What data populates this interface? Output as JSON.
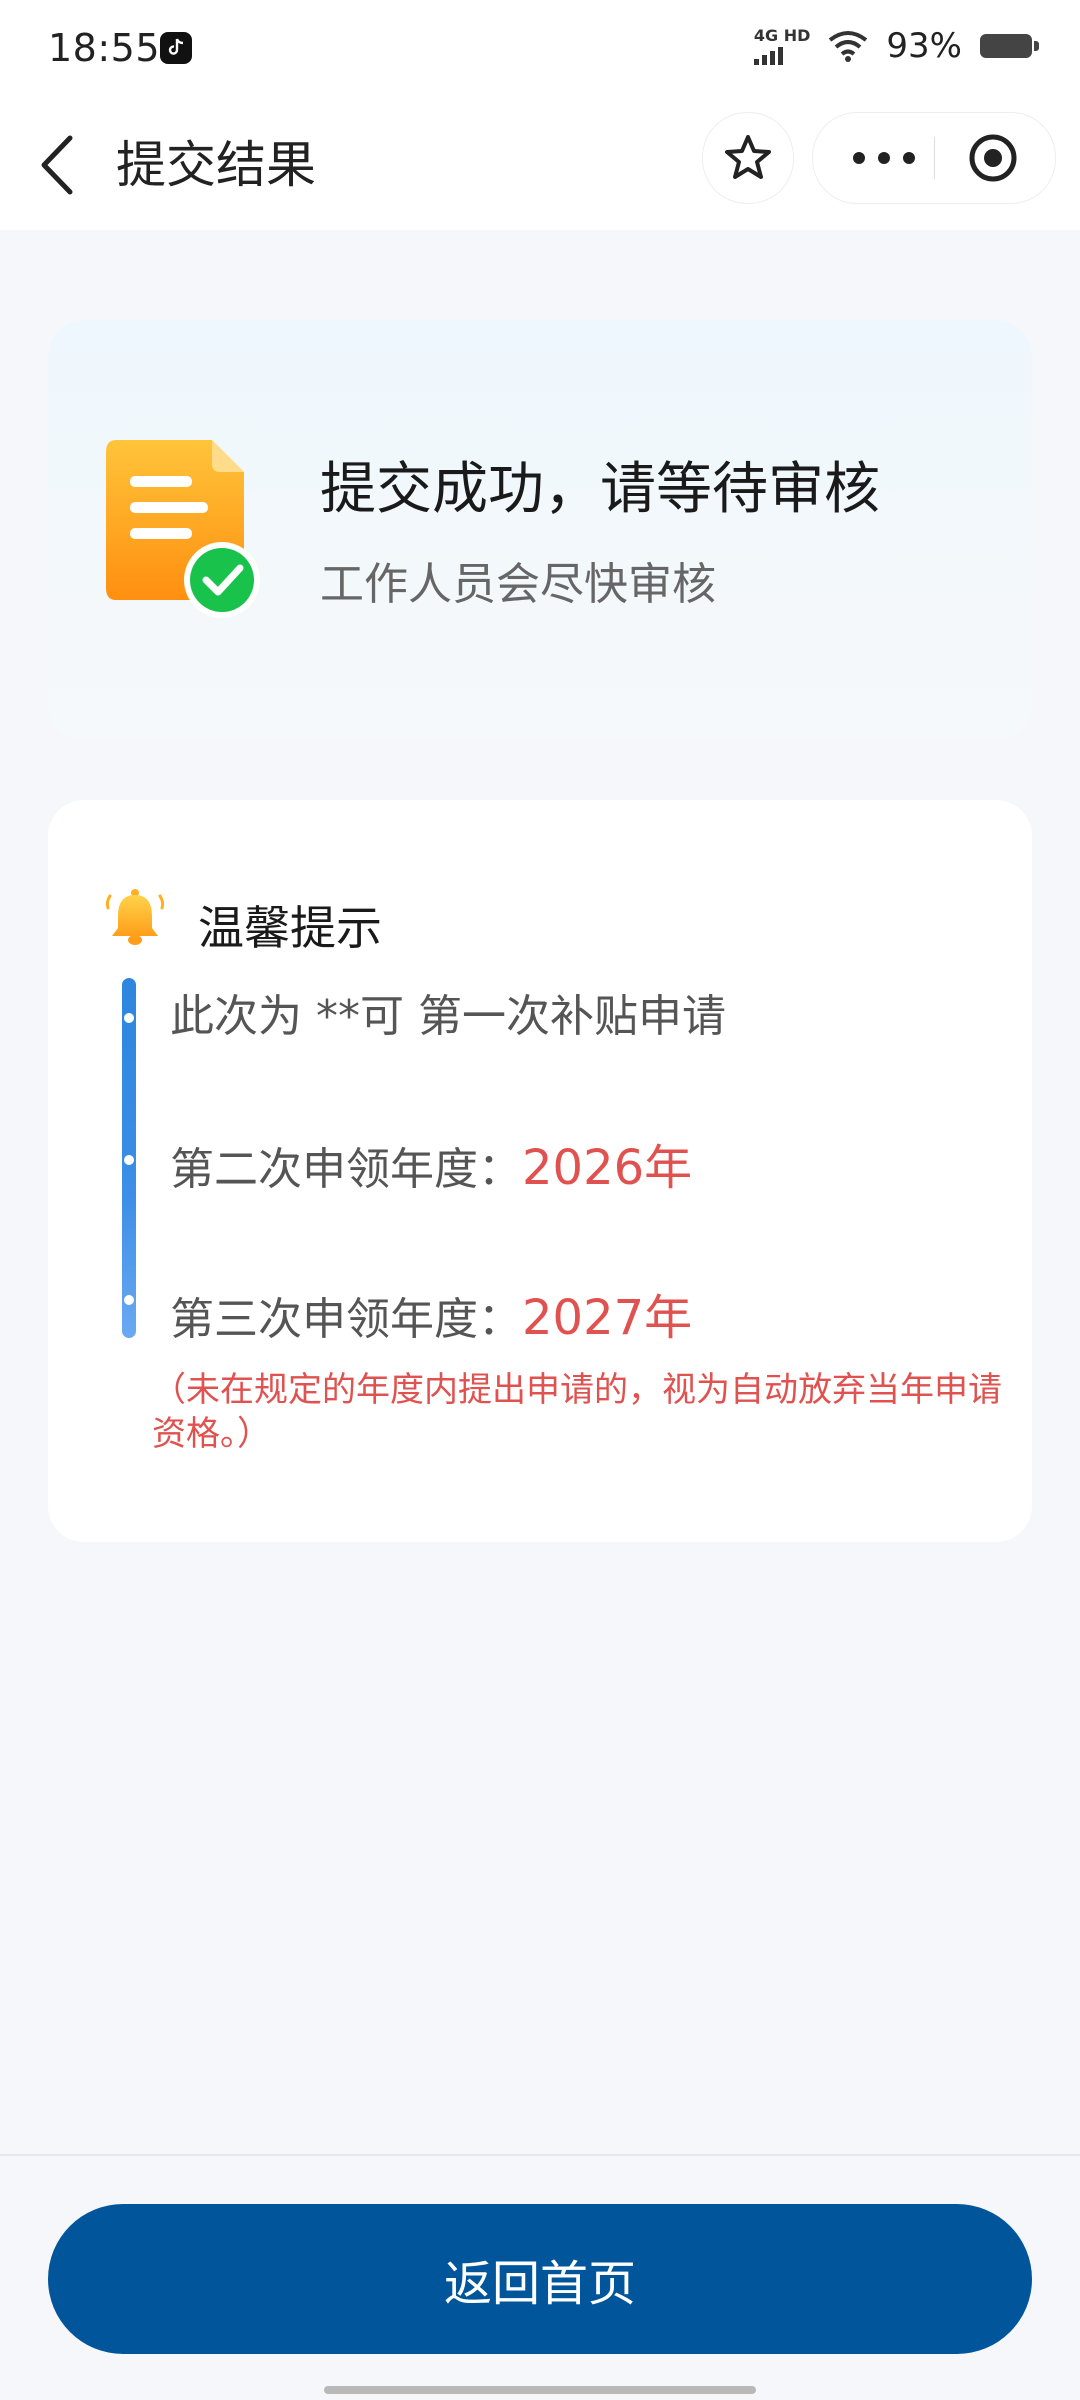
{
  "status_bar": {
    "time": "18:55",
    "network": "4G HD",
    "battery": "93%"
  },
  "header": {
    "title": "提交结果",
    "icons": [
      "back-arrow-icon",
      "star-icon",
      "more-icon",
      "target-icon"
    ]
  },
  "success": {
    "title": "提交成功，请等待审核",
    "subtitle": "工作人员会尽快审核",
    "icon": "document-check-icon"
  },
  "tips": {
    "title": "温馨提示",
    "icon": "bell-icon",
    "line1": "此次为 **可 第一次补贴申请",
    "line2_label": "第二次申领年度：",
    "line2_year": "2026年",
    "line3_label": "第三次申领年度：",
    "line3_year": "2027年",
    "note": "（未在规定的年度内提出申请的，视为自动放弃当年申请资格。）"
  },
  "footer": {
    "button_label": "返回首页"
  },
  "colors": {
    "primary": "#01569b",
    "highlight": "#e0524f",
    "timeline": "#2e86de"
  }
}
